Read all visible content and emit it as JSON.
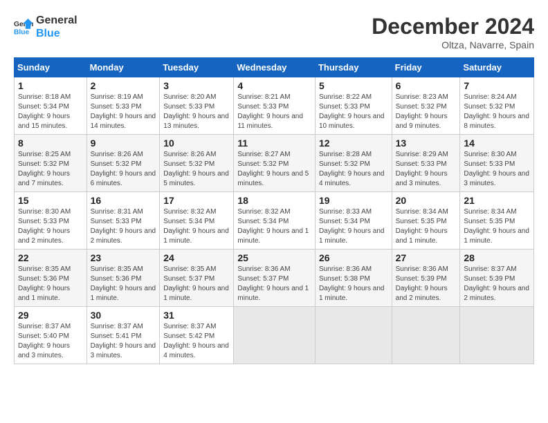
{
  "logo": {
    "line1": "General",
    "line2": "Blue"
  },
  "title": "December 2024",
  "subtitle": "Oltza, Navarre, Spain",
  "headers": [
    "Sunday",
    "Monday",
    "Tuesday",
    "Wednesday",
    "Thursday",
    "Friday",
    "Saturday"
  ],
  "weeks": [
    [
      {
        "day": "1",
        "info": "Sunrise: 8:18 AM\nSunset: 5:34 PM\nDaylight: 9 hours and 15 minutes."
      },
      {
        "day": "2",
        "info": "Sunrise: 8:19 AM\nSunset: 5:33 PM\nDaylight: 9 hours and 14 minutes."
      },
      {
        "day": "3",
        "info": "Sunrise: 8:20 AM\nSunset: 5:33 PM\nDaylight: 9 hours and 13 minutes."
      },
      {
        "day": "4",
        "info": "Sunrise: 8:21 AM\nSunset: 5:33 PM\nDaylight: 9 hours and 11 minutes."
      },
      {
        "day": "5",
        "info": "Sunrise: 8:22 AM\nSunset: 5:33 PM\nDaylight: 9 hours and 10 minutes."
      },
      {
        "day": "6",
        "info": "Sunrise: 8:23 AM\nSunset: 5:32 PM\nDaylight: 9 hours and 9 minutes."
      },
      {
        "day": "7",
        "info": "Sunrise: 8:24 AM\nSunset: 5:32 PM\nDaylight: 9 hours and 8 minutes."
      }
    ],
    [
      {
        "day": "8",
        "info": "Sunrise: 8:25 AM\nSunset: 5:32 PM\nDaylight: 9 hours and 7 minutes."
      },
      {
        "day": "9",
        "info": "Sunrise: 8:26 AM\nSunset: 5:32 PM\nDaylight: 9 hours and 6 minutes."
      },
      {
        "day": "10",
        "info": "Sunrise: 8:26 AM\nSunset: 5:32 PM\nDaylight: 9 hours and 5 minutes."
      },
      {
        "day": "11",
        "info": "Sunrise: 8:27 AM\nSunset: 5:32 PM\nDaylight: 9 hours and 5 minutes."
      },
      {
        "day": "12",
        "info": "Sunrise: 8:28 AM\nSunset: 5:32 PM\nDaylight: 9 hours and 4 minutes."
      },
      {
        "day": "13",
        "info": "Sunrise: 8:29 AM\nSunset: 5:33 PM\nDaylight: 9 hours and 3 minutes."
      },
      {
        "day": "14",
        "info": "Sunrise: 8:30 AM\nSunset: 5:33 PM\nDaylight: 9 hours and 3 minutes."
      }
    ],
    [
      {
        "day": "15",
        "info": "Sunrise: 8:30 AM\nSunset: 5:33 PM\nDaylight: 9 hours and 2 minutes."
      },
      {
        "day": "16",
        "info": "Sunrise: 8:31 AM\nSunset: 5:33 PM\nDaylight: 9 hours and 2 minutes."
      },
      {
        "day": "17",
        "info": "Sunrise: 8:32 AM\nSunset: 5:34 PM\nDaylight: 9 hours and 1 minute."
      },
      {
        "day": "18",
        "info": "Sunrise: 8:32 AM\nSunset: 5:34 PM\nDaylight: 9 hours and 1 minute."
      },
      {
        "day": "19",
        "info": "Sunrise: 8:33 AM\nSunset: 5:34 PM\nDaylight: 9 hours and 1 minute."
      },
      {
        "day": "20",
        "info": "Sunrise: 8:34 AM\nSunset: 5:35 PM\nDaylight: 9 hours and 1 minute."
      },
      {
        "day": "21",
        "info": "Sunrise: 8:34 AM\nSunset: 5:35 PM\nDaylight: 9 hours and 1 minute."
      }
    ],
    [
      {
        "day": "22",
        "info": "Sunrise: 8:35 AM\nSunset: 5:36 PM\nDaylight: 9 hours and 1 minute."
      },
      {
        "day": "23",
        "info": "Sunrise: 8:35 AM\nSunset: 5:36 PM\nDaylight: 9 hours and 1 minute."
      },
      {
        "day": "24",
        "info": "Sunrise: 8:35 AM\nSunset: 5:37 PM\nDaylight: 9 hours and 1 minute."
      },
      {
        "day": "25",
        "info": "Sunrise: 8:36 AM\nSunset: 5:37 PM\nDaylight: 9 hours and 1 minute."
      },
      {
        "day": "26",
        "info": "Sunrise: 8:36 AM\nSunset: 5:38 PM\nDaylight: 9 hours and 1 minute."
      },
      {
        "day": "27",
        "info": "Sunrise: 8:36 AM\nSunset: 5:39 PM\nDaylight: 9 hours and 2 minutes."
      },
      {
        "day": "28",
        "info": "Sunrise: 8:37 AM\nSunset: 5:39 PM\nDaylight: 9 hours and 2 minutes."
      }
    ],
    [
      {
        "day": "29",
        "info": "Sunrise: 8:37 AM\nSunset: 5:40 PM\nDaylight: 9 hours and 3 minutes."
      },
      {
        "day": "30",
        "info": "Sunrise: 8:37 AM\nSunset: 5:41 PM\nDaylight: 9 hours and 3 minutes."
      },
      {
        "day": "31",
        "info": "Sunrise: 8:37 AM\nSunset: 5:42 PM\nDaylight: 9 hours and 4 minutes."
      },
      null,
      null,
      null,
      null
    ]
  ]
}
